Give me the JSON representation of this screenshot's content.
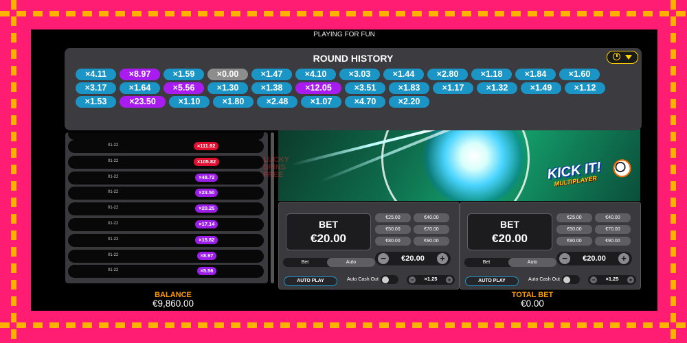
{
  "header": {
    "status_text": "PLAYING FOR FUN"
  },
  "round_history": {
    "title": "ROUND HISTORY",
    "rows": [
      [
        {
          "v": "×4.11",
          "c": "blue"
        },
        {
          "v": "×8.97",
          "c": "purple"
        },
        {
          "v": "×1.59",
          "c": "blue"
        },
        {
          "v": "×0.00",
          "c": "grey"
        },
        {
          "v": "×1.47",
          "c": "blue"
        },
        {
          "v": "×4.10",
          "c": "blue"
        },
        {
          "v": "×3.03",
          "c": "blue"
        },
        {
          "v": "×1.44",
          "c": "blue"
        },
        {
          "v": "×2.80",
          "c": "blue"
        },
        {
          "v": "×1.18",
          "c": "blue"
        },
        {
          "v": "×1.84",
          "c": "blue"
        },
        {
          "v": "×1.60",
          "c": "blue"
        }
      ],
      [
        {
          "v": "×3.17",
          "c": "blue"
        },
        {
          "v": "×1.64",
          "c": "blue"
        },
        {
          "v": "×5.56",
          "c": "purple"
        },
        {
          "v": "×1.30",
          "c": "blue"
        },
        {
          "v": "×1.38",
          "c": "blue"
        },
        {
          "v": "×12.05",
          "c": "purple"
        },
        {
          "v": "×3.51",
          "c": "blue"
        },
        {
          "v": "×1.83",
          "c": "blue"
        },
        {
          "v": "×1.17",
          "c": "blue"
        },
        {
          "v": "×1.32",
          "c": "blue"
        },
        {
          "v": "×1.49",
          "c": "blue"
        },
        {
          "v": "×1.12",
          "c": "blue"
        }
      ],
      [
        {
          "v": "×1.53",
          "c": "blue"
        },
        {
          "v": "×23.50",
          "c": "purple"
        },
        {
          "v": "×1.10",
          "c": "blue"
        },
        {
          "v": "×1.80",
          "c": "blue"
        },
        {
          "v": "×2.48",
          "c": "blue"
        },
        {
          "v": "×1.07",
          "c": "blue"
        },
        {
          "v": "×4.70",
          "c": "blue"
        },
        {
          "v": "×2.20",
          "c": "blue"
        }
      ]
    ]
  },
  "bets_list": [
    {
      "date": "01-22",
      "mult": "×111.92",
      "color": "red"
    },
    {
      "date": "01-22",
      "mult": "×105.82",
      "color": "red"
    },
    {
      "date": "01-22",
      "mult": "×48.72",
      "color": "purple"
    },
    {
      "date": "01-22",
      "mult": "×23.50",
      "color": "purple"
    },
    {
      "date": "01-22",
      "mult": "×20.25",
      "color": "purple"
    },
    {
      "date": "01-22",
      "mult": "×17.14",
      "color": "purple"
    },
    {
      "date": "01-22",
      "mult": "×15.82",
      "color": "purple"
    },
    {
      "date": "01-22",
      "mult": "×8.97",
      "color": "purple"
    },
    {
      "date": "01-22",
      "mult": "×5.56",
      "color": "purple"
    }
  ],
  "game_logo": {
    "title": "KICK IT!",
    "subtitle": "MULTIPLAYER"
  },
  "watermark": [
    "LUCKY",
    "SPINS",
    "FREE"
  ],
  "bet_panels": [
    {
      "bet_label": "BET",
      "bet_amount": "€20.00",
      "presets": [
        "€25.00",
        "€40.00",
        "€50.00",
        "€70.00",
        "€80.00",
        "€90.00"
      ],
      "tab_bet": "Bet",
      "tab_auto": "Auto",
      "stepper_value": "€20.00",
      "autoplay": "AUTO PLAY",
      "auto_cashout": "Auto Cash Out",
      "cashout_value": "×1.25"
    },
    {
      "bet_label": "BET",
      "bet_amount": "€20.00",
      "presets": [
        "€25.00",
        "€40.00",
        "€50.00",
        "€70.00",
        "€80.00",
        "€90.00"
      ],
      "tab_bet": "Bet",
      "tab_auto": "Auto",
      "stepper_value": "€20.00",
      "autoplay": "AUTO PLAY",
      "auto_cashout": "Auto Cash Out",
      "cashout_value": "×1.25"
    }
  ],
  "footer": {
    "balance_label": "BALANCE",
    "balance_value": "€9,860.00",
    "total_bet_label": "TOTAL BET",
    "total_bet_value": "€0.00"
  },
  "colors": {
    "frame": "#ff1c72",
    "frame_dash": "#ffb100",
    "chip_blue": "#1b95c6",
    "chip_purple": "#a81cf0",
    "chip_grey": "#8d8d8d",
    "accent_orange": "#ff9d00"
  }
}
